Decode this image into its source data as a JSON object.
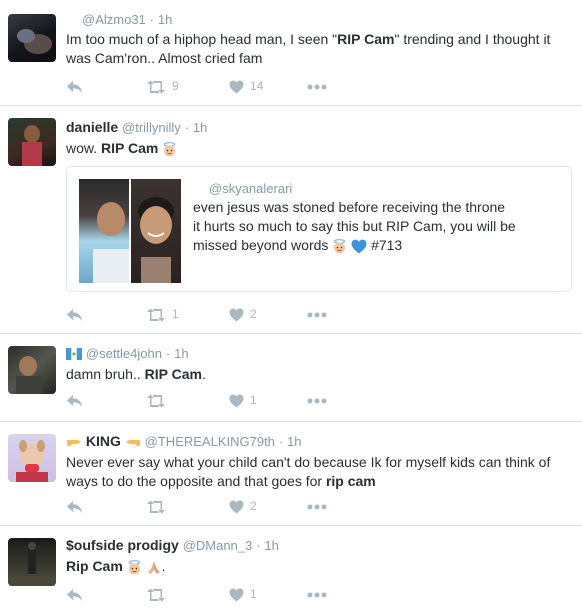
{
  "tweets": [
    {
      "name": "",
      "handle": "@Alzmo31",
      "time": "1h",
      "text_parts": [
        "Im too much of a hiphop head man, I seen \"",
        "RIP Cam",
        "\" trending and I thought it was Cam'ron.. Almost cried fam"
      ],
      "retweets": "9",
      "likes": "14"
    },
    {
      "name": "danielle",
      "handle": "@trillynilly",
      "time": "1h",
      "text_parts": [
        "wow. ",
        "RIP Cam"
      ],
      "retweets": "1",
      "likes": "2",
      "quote": {
        "handle": "@skyanalerari",
        "line1": "even jesus was stoned before receiving the throne",
        "line2": "it hurts so much to say this but RIP Cam, you will be missed beyond words",
        "hashtag": "#713"
      }
    },
    {
      "name": "",
      "handle": "@settle4john",
      "time": "1h",
      "text_parts": [
        "damn bruh.. ",
        "RIP Cam",
        "."
      ],
      "retweets": "",
      "likes": "1"
    },
    {
      "name": "KING",
      "handle": "@THEREALKING79th",
      "time": "1h",
      "text_parts": [
        "Never ever say what your child can't do because Ik for myself kids can think of ways to do the opposite and that goes for ",
        "rip cam"
      ],
      "retweets": "",
      "likes": "2"
    },
    {
      "name": "$oufside prodigy",
      "handle": "@DMann_3",
      "time": "1h",
      "text_parts": [
        "Rip Cam",
        "."
      ],
      "retweets": "",
      "likes": "1"
    }
  ],
  "separator": "·",
  "colors": {
    "text": "#292f33",
    "muted": "#8899a6",
    "icon": "#aab8c2",
    "border": "#e1e8ed",
    "heart_blue": "#3b94d9"
  }
}
